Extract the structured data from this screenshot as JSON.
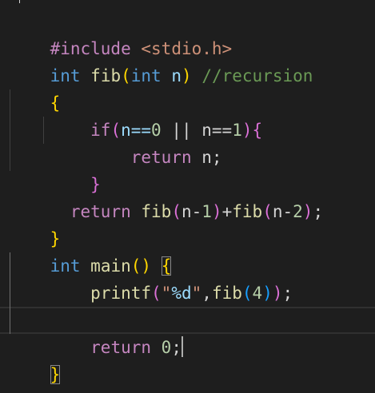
{
  "colors": {
    "background": "#1e1e1e",
    "text": "#d4d4d4",
    "keyword_control": "#c586c0",
    "keyword_type": "#569cd6",
    "function": "#dcdcaa",
    "parameter": "#9cdcfe",
    "comment": "#6a9955",
    "number": "#b5cea8",
    "string": "#ce9178",
    "bracket_level_1": "#ffd700",
    "bracket_level_2": "#da70d6",
    "bracket_level_3": "#179fff"
  },
  "code": {
    "l1": {
      "directive": "#include",
      "sp": " ",
      "header": "<stdio.h>"
    },
    "l2": {
      "type": "int",
      "sp": " ",
      "fn": "fib",
      "open": "(",
      "ptype": "int",
      "sp2": " ",
      "pname": "n",
      "close": ")",
      "sp3": " ",
      "comment": "//recursion"
    },
    "l3": {
      "brace": "{"
    },
    "l4": {
      "indent": "    ",
      "kw": "if",
      "open": "(",
      "t1": "n==",
      "n0": "0",
      "t2": " || n==",
      "n1": "1",
      "close": ")",
      "brace": "{"
    },
    "l5": {
      "indent": "        ",
      "kw": "return",
      "rest": " n;"
    },
    "l6": {
      "indent": "    ",
      "brace": "}"
    },
    "l7": {
      "indent": "  ",
      "kw": "return",
      "sp": " ",
      "fn1": "fib",
      "o1": "(",
      "a1": "n-",
      "n1": "1",
      "c1": ")",
      "plus": "+",
      "fn2": "fib",
      "o2": "(",
      "a2": "n-",
      "n2": "2",
      "c2": ")",
      "semi": ";"
    },
    "l8": {
      "brace": "}"
    },
    "l9": {
      "type": "int",
      "sp": " ",
      "fn": "main",
      "parens": "()",
      "sp2": " ",
      "brace": "{"
    },
    "l10": {
      "indent": "    ",
      "fn": "printf",
      "o1": "(",
      "q1": "\"",
      "fmt": "%d",
      "q2": "\"",
      "comma": ",",
      "fn2": "fib",
      "o2": "(",
      "num": "4",
      "c2": ")",
      "c1": ")",
      "semi": ";"
    },
    "l11": {
      "text": ""
    },
    "l12": {
      "indent": "    ",
      "kw": "return",
      "sp": " ",
      "num": "0",
      "semi": ";"
    },
    "l13": {
      "brace": "}"
    }
  }
}
